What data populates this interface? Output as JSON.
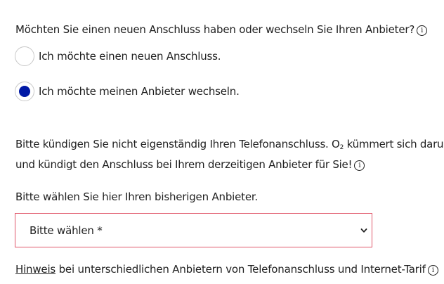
{
  "question": {
    "text": "Möchten Sie einen neuen Anschluss haben oder wechseln Sie Ihren Anbieter?",
    "info_icon": "info-icon"
  },
  "options": [
    {
      "label": "Ich möchte einen neuen Anschluss.",
      "selected": false
    },
    {
      "label": "Ich möchte meinen Anbieter wechseln.",
      "selected": true
    }
  ],
  "notice": {
    "line1_before": "Bitte kündigen Sie nicht eigenständig Ihren Telefonanschluss. O",
    "subscript": "2",
    "line1_after": " kümmert sich darum",
    "line2": "und kündigt den Anschluss bei Ihrem derzeitigen Anbieter für Sie!"
  },
  "provider": {
    "label": "Bitte wählen Sie hier Ihren bisherigen Anbieter.",
    "selected_value": "Bitte wählen *",
    "border_color": "#e0566a"
  },
  "hint": {
    "link_text": "Hinweis",
    "text": " bei unterschiedlichen Anbietern von Telefonanschluss und Internet-Tarif"
  },
  "colors": {
    "accent": "#0019a5",
    "error": "#e0566a"
  }
}
